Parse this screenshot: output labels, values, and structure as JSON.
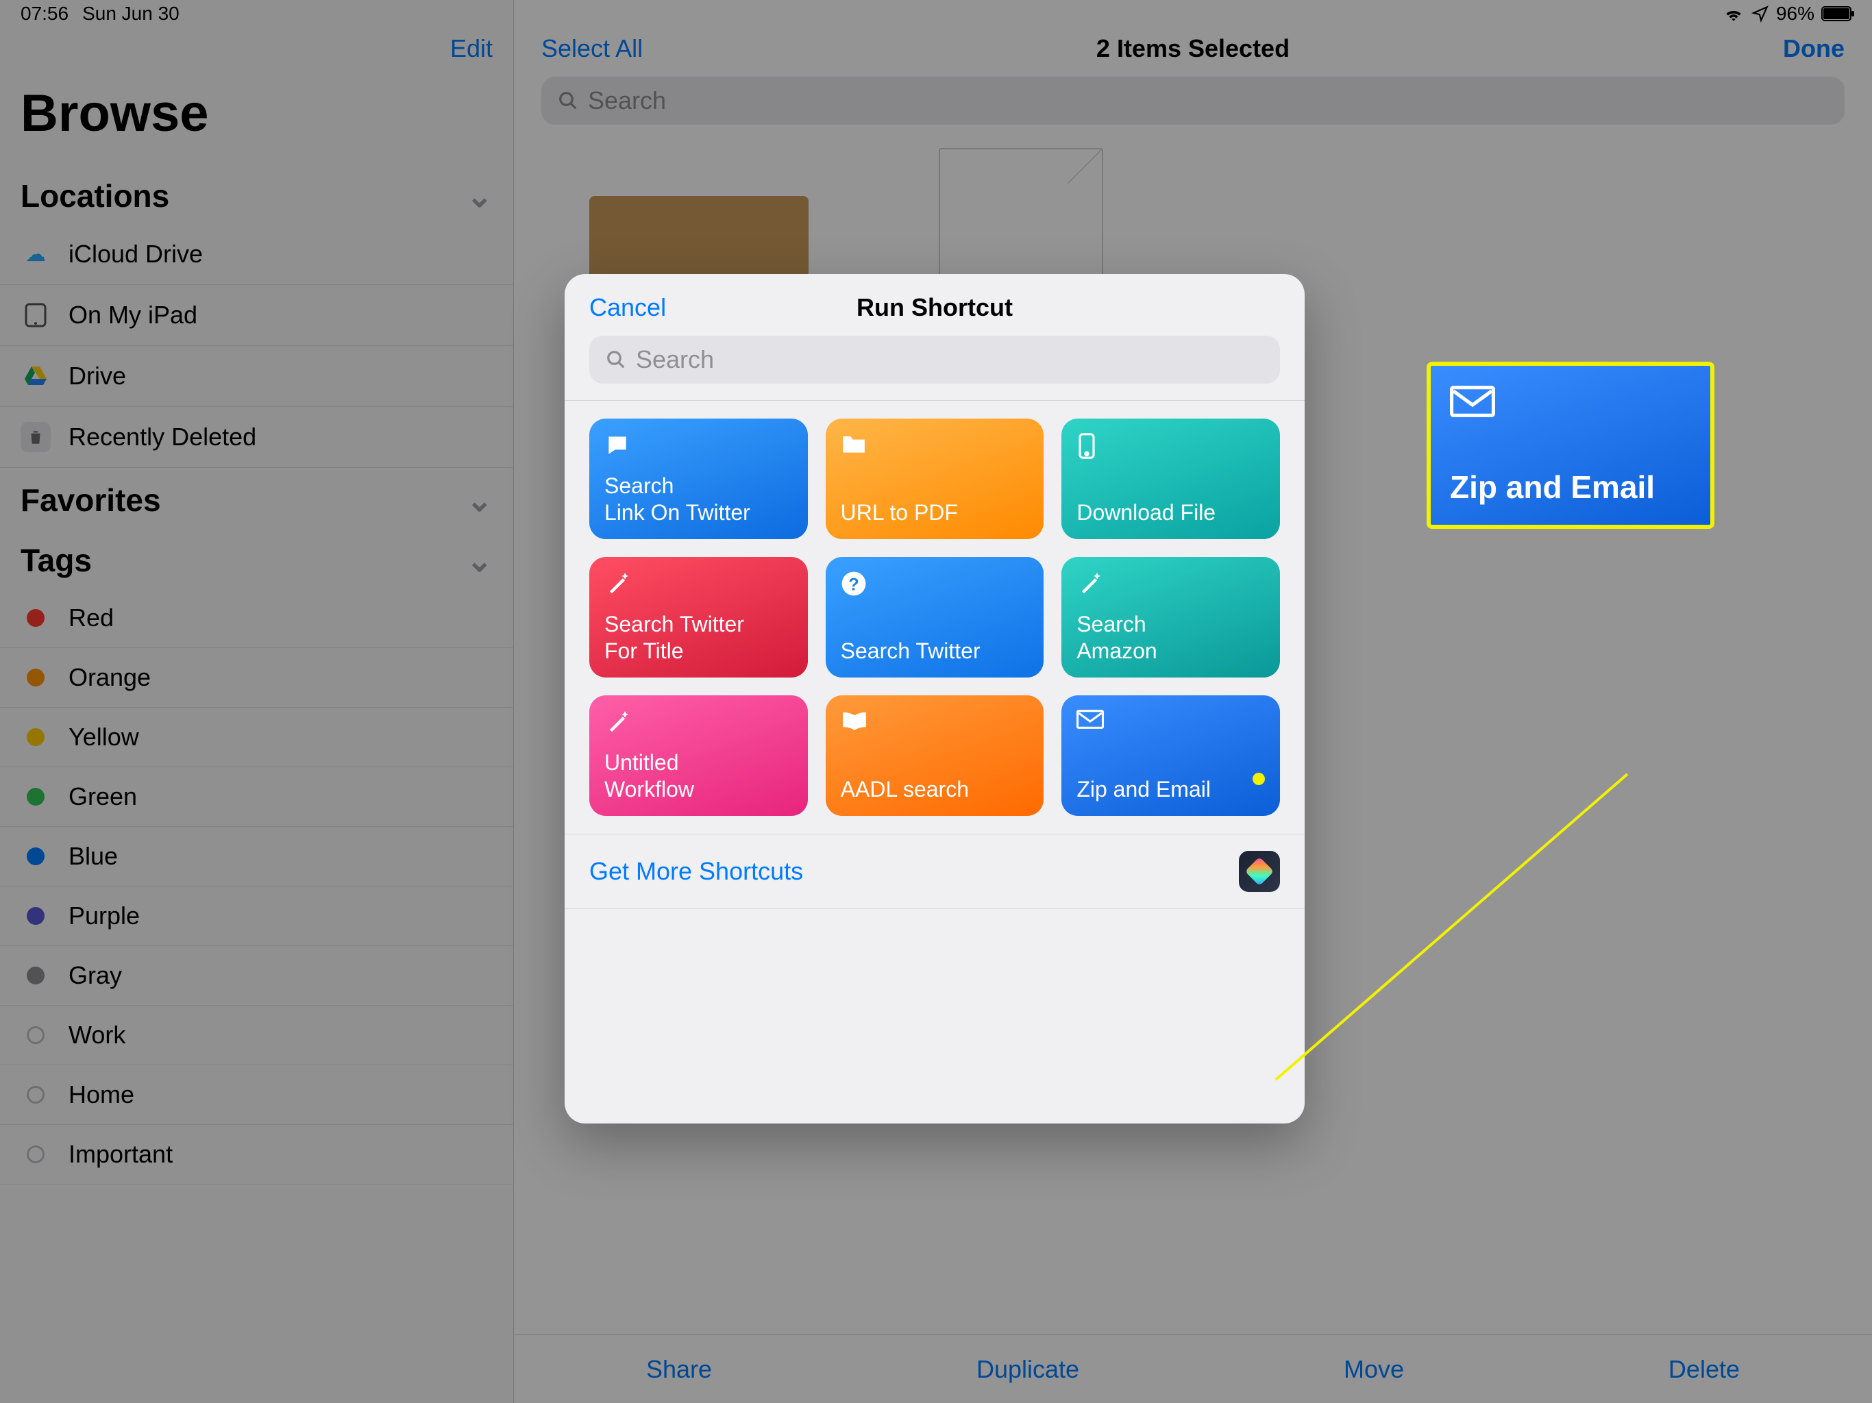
{
  "status": {
    "time": "07:56",
    "date": "Sun Jun 30",
    "battery": "96%"
  },
  "sidebar": {
    "edit": "Edit",
    "title": "Browse",
    "sections": {
      "locations": {
        "label": "Locations"
      },
      "favorites": {
        "label": "Favorites"
      },
      "tags": {
        "label": "Tags"
      }
    },
    "locations": [
      {
        "label": "iCloud Drive"
      },
      {
        "label": "On My iPad"
      },
      {
        "label": "Drive"
      },
      {
        "label": "Recently Deleted"
      }
    ],
    "tags": [
      {
        "label": "Red",
        "color": "#ff3b30"
      },
      {
        "label": "Orange",
        "color": "#ff9500"
      },
      {
        "label": "Yellow",
        "color": "#ffcc00"
      },
      {
        "label": "Green",
        "color": "#34c759"
      },
      {
        "label": "Blue",
        "color": "#007aff"
      },
      {
        "label": "Purple",
        "color": "#5856d6"
      },
      {
        "label": "Gray",
        "color": "#8e8e93"
      },
      {
        "label": "Work"
      },
      {
        "label": "Home"
      },
      {
        "label": "Important"
      }
    ]
  },
  "main": {
    "select_all": "Select All",
    "title": "2 Items Selected",
    "done": "Done",
    "search_placeholder": "Search",
    "toolbar": {
      "share": "Share",
      "duplicate": "Duplicate",
      "move": "Move",
      "delete": "Delete"
    }
  },
  "modal": {
    "cancel": "Cancel",
    "title": "Run Shortcut",
    "search_placeholder": "Search",
    "get_more": "Get More Shortcuts",
    "shortcuts": [
      {
        "label": "Search\nLink On Twitter",
        "icon": "speech"
      },
      {
        "label": "URL to PDF",
        "icon": "folder"
      },
      {
        "label": "Download File",
        "icon": "phone"
      },
      {
        "label": "Search Twitter\nFor Title",
        "icon": "wand"
      },
      {
        "label": "Search Twitter",
        "icon": "question"
      },
      {
        "label": "Search\nAmazon",
        "icon": "wand"
      },
      {
        "label": "Untitled\nWorkflow",
        "icon": "wand"
      },
      {
        "label": "AADL search",
        "icon": "book"
      },
      {
        "label": "Zip and Email",
        "icon": "mail"
      }
    ]
  },
  "callout": {
    "label": "Zip and Email"
  }
}
